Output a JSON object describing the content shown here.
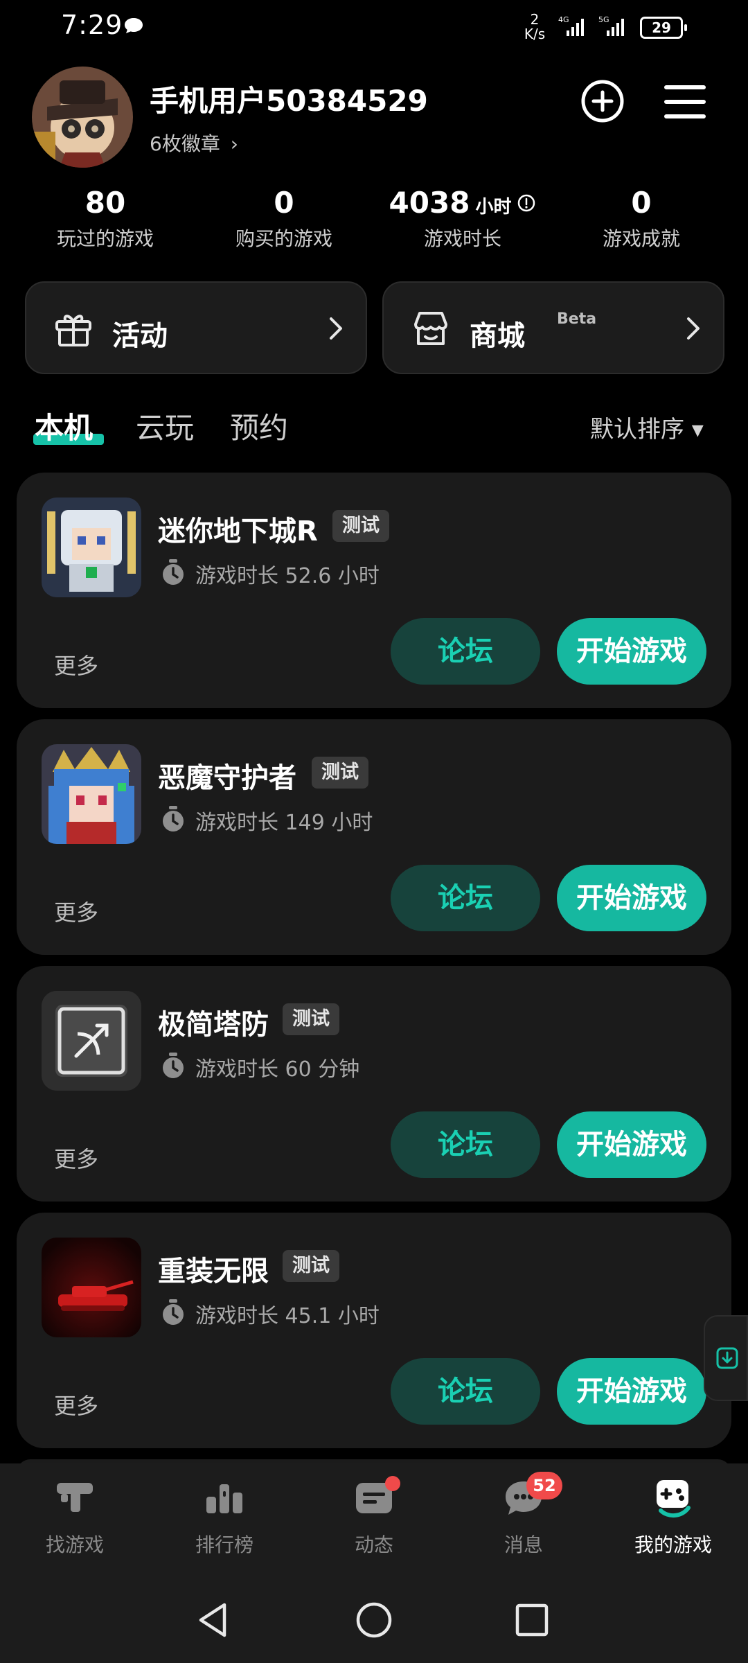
{
  "status_bar": {
    "time": "7:29",
    "speed_value": "2",
    "speed_unit": "K/s",
    "net1": "4G",
    "net2": "5G",
    "battery": "29"
  },
  "profile": {
    "username": "手机用户50384529",
    "badges": "6枚徽章",
    "badges_chevron": "›"
  },
  "stats": [
    {
      "value": "80",
      "label": "玩过的游戏"
    },
    {
      "value": "0",
      "label": "购买的游戏"
    },
    {
      "value": "4038",
      "unit": "小时",
      "label": "游戏时长"
    },
    {
      "value": "0",
      "label": "游戏成就"
    }
  ],
  "quick": {
    "activity": "活动",
    "shop": "商城",
    "shop_tag": "Beta"
  },
  "tabs": [
    "本机",
    "云玩",
    "预约"
  ],
  "sort_label": "默认排序 ▾",
  "games": [
    {
      "title": "迷你地下城R",
      "tag": "测试",
      "time": "游戏时长 52.6 小时"
    },
    {
      "title": "恶魔守护者",
      "tag": "测试",
      "time": "游戏时长 149 小时"
    },
    {
      "title": "极简塔防",
      "tag": "测试",
      "time": "游戏时长 60 分钟"
    },
    {
      "title": "重装无限",
      "tag": "测试",
      "time": "游戏时长 45.1 小时"
    }
  ],
  "game_actions": {
    "more": "更多",
    "forum": "论坛",
    "play": "开始游戏"
  },
  "bottom_nav": [
    {
      "label": "找游戏",
      "icon": "find-games-icon"
    },
    {
      "label": "排行榜",
      "icon": "ranking-icon"
    },
    {
      "label": "动态",
      "icon": "feed-icon"
    },
    {
      "label": "消息",
      "icon": "message-icon"
    },
    {
      "label": "我的游戏",
      "icon": "gamepad-icon"
    }
  ],
  "message_badge": "52",
  "colors": {
    "accent": "#16b8a0",
    "forum_bg": "#17433c",
    "card_bg": "#1b1b1b"
  }
}
